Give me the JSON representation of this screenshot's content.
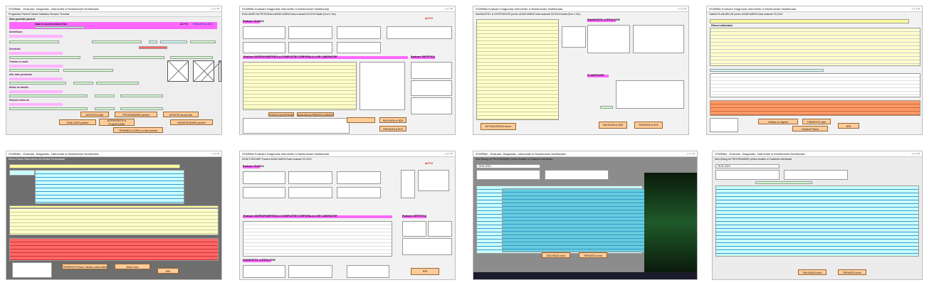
{
  "windows": [
    {
      "title": "STARBitz - Evaluare, Diagnostic, Interventie si Monitorizare Nutritionala",
      "menu": "Programari   Pacienti   Tabele   Statistica   Structuri   Terminal",
      "section_general": "Date generale pacient",
      "section_identif": "Identificare",
      "section_domiciliu": "Domiciliu",
      "section_telefon": "Telefon si email",
      "section_alte": "Alte date personale",
      "section_medic": "Medic de familie",
      "section_pacient": "Pacient trimis de",
      "date_label": "Data si ora deschiderii fisei",
      "alt_label": "ALT+X",
      "renunta": "RENUNTA si IESI",
      "btn_modifica": "MODIFICA date",
      "btn_programare": "PROGRAMARE pacient",
      "btn_atentie": "ATENTIE anunta fise",
      "btn_evaluare": "EVALUARE pacient",
      "btn_interventie": "INTERVENTIE si PLANIFICARE MONITORIZARE",
      "btn_monitorizare": "MONITORIZARE pacient",
      "btn_termina": "TERMINA LUCRUL cu fisa curenta"
    },
    {
      "title": "STARBitz Evaluare Diagnostic Interventie si Monitorizare Nutritionala",
      "subtitle": "EVALUARE NUTRITIONALA ADMS AMEM  Data evaluarii 03.2019 Nadia (Sun e Viu)",
      "sec_clinice": "Evaluare CLINICA",
      "sec_antropo": "Evaluare ANTROPOMETRICA si COMPOZITIE CORPORALA si DE LABORATOR",
      "sec_dietetica": "Evaluare DIETETICA",
      "alt_label": "ALT+X",
      "btn_salveaza": "SALVEAZA si IESI",
      "btn_renunta": "RENUNTA si IESI",
      "btn_nutrienti": "ADAUGA NUTRIENTI si MICRONUTRIENTI",
      "btn_status": "STATUS NUTRITIONAL"
    },
    {
      "title": "STARBitz Evaluare Diagnostic Interventie si Monitorizare Nutritionala",
      "subtitle": "DIAGNOSTIC si INTERVENTIE pentru ADMS AMEM  Data evaluarii 03.2019 Nadia (Sun e Viu)",
      "sec_diagnostic": "DIAGNOSTIC si ETIOLOGIE",
      "sec_planificare": "PLANIFICARE",
      "btn_salveaza": "SALVEAZA si IESI",
      "btn_renunta": "RENUNTA si IESI",
      "btn_actualizare": "ACTUALIZEAZA norme"
    },
    {
      "title": "STARBitz Evaluare Diagnostic Interventie si Monitorizare Nutritionala",
      "subtitle": "Tabelul PLANURILOR pentru ADMS AMEM  Data evaluarii 03.2019",
      "table_title": "Planuri alimentare",
      "btn_iesi": "IESI",
      "btn_tiparire": "TIPARESTE plan",
      "btn_verifica": "Verifica cu regimul",
      "btn_nutrienti": "Nutrienti Planul"
    },
    {
      "title": "STARBitz - Evaluare, Diagnostic, Interventie si Monitorizare Nutritionala",
      "subtitle": "Meniu Planul (Sauri dinner din Meniul Personalizat)",
      "btn_iesi": "IESI",
      "btn_tipareste": "TIPARESTE Planul, Meniul curent selectat",
      "btn_meniu_nou": "Meniu Nou"
    },
    {
      "title": "STARBitz Evaluare Diagnostic Interventie si Monitorizare Nutritionala",
      "subtitle": "MONITORIZARE Pacient ADMS AMEM  Data evaluarii 03.2019",
      "sec_clinice": "Evaluare CLINICA",
      "sec_antropo": "Evaluare ANTROPOMETRICA si COMPOZITIE CORPORALA si DE LABORATOR",
      "sec_dietetica": "Evaluare DIETETICA",
      "sec_diagnostic": "DIAGNOSTIC si ETIOLOGIE",
      "alt_label": "ALT+X",
      "btn_iesi": "IESI"
    },
    {
      "title": "STARBitz - Evaluare, Diagnostic, Interventie si Monitorizare Nutritionala",
      "subtitle": "Mod Dialog de PROGRAMARE pentru Analize si Calatorie Individuala",
      "btn_salveaza": "SALVEAZA zona",
      "btn_renunta": "RENUNTA zona",
      "selected_date": "15.01.2019"
    },
    {
      "title": "STARBitz - Evaluare, Diagnostic, Interventie si Monitorizare Nutritionala",
      "subtitle": "Mod Dialog de PROGRAMARE pentru Analize si Calatorie Individuala",
      "btn_salveaza": "SALVEAZA zona",
      "btn_renunta": "RENUNTA zona",
      "selected_date": "15.01.2019"
    }
  ]
}
